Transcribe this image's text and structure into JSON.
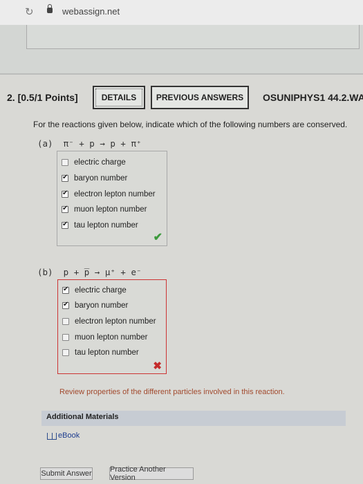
{
  "browser": {
    "url": "webassign.net",
    "reload_icon": "reload-icon",
    "lock_icon": "lock-icon"
  },
  "question": {
    "title": "2.  [0.5/1 Points]",
    "details_label": "DETAILS",
    "previous_answers_label": "PREVIOUS ANSWERS",
    "code": "OSUNIPHYS1 44.2.WA.",
    "instructions": "For the reactions given below, indicate which of the following numbers are conserved."
  },
  "parts": [
    {
      "label": "(a)",
      "reaction": "π⁻ + p → p + π⁺",
      "result": "correct",
      "options": [
        {
          "label": "electric charge",
          "checked": false
        },
        {
          "label": "baryon number",
          "checked": true
        },
        {
          "label": "electron lepton number",
          "checked": true
        },
        {
          "label": "muon lepton number",
          "checked": true
        },
        {
          "label": "tau lepton number",
          "checked": true
        }
      ]
    },
    {
      "label": "(b)",
      "reaction": "p + p̅ → μ⁺ + e⁻",
      "result": "incorrect",
      "options": [
        {
          "label": "electric charge",
          "checked": true
        },
        {
          "label": "baryon number",
          "checked": true
        },
        {
          "label": "electron lepton number",
          "checked": false
        },
        {
          "label": "muon lepton number",
          "checked": false
        },
        {
          "label": "tau lepton number",
          "checked": false
        }
      ],
      "hint": "Review properties of the different particles involved in this reaction."
    }
  ],
  "materials": {
    "title": "Additional Materials",
    "ebook_label": "eBook"
  },
  "actions": {
    "submit_label": "Submit Answer",
    "practice_label": "Practice Another Version"
  },
  "colors": {
    "correct": "#3c9a3c",
    "incorrect": "#c42b2b",
    "hint": "#a24a2e",
    "link": "#1e3d8f"
  }
}
